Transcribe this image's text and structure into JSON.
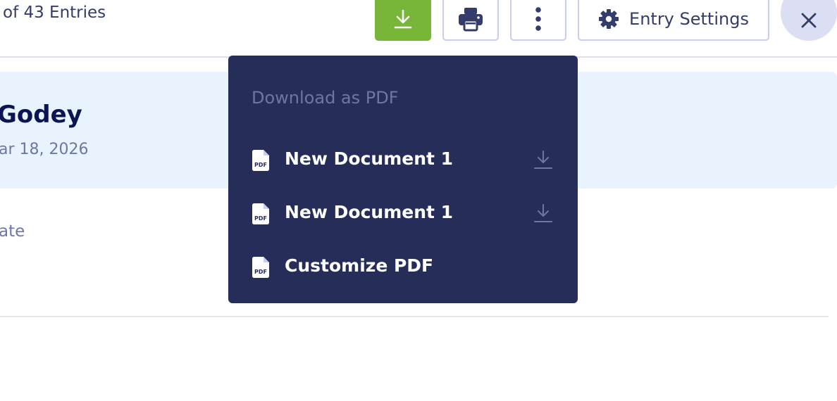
{
  "toolbar": {
    "entry_count_text": "of 43 Entries",
    "settings_label": "Entry Settings",
    "icons": {
      "download": "download-icon",
      "print": "print-icon",
      "more": "more-vertical-icon",
      "settings": "gear-icon",
      "close": "close-icon"
    },
    "colors": {
      "download_button": "#78b63a",
      "close_button": "#dcdff4"
    }
  },
  "submission": {
    "name": "Godey",
    "date": "ar 18, 2026",
    "field_label": "ate"
  },
  "download_menu": {
    "heading": "Download as PDF",
    "items": [
      {
        "label": "New Document 1",
        "icon": "pdf-file-icon",
        "action_icon": "download-icon"
      },
      {
        "label": "New Document 1",
        "icon": "pdf-file-icon",
        "action_icon": "download-icon"
      },
      {
        "label": "Customize PDF",
        "icon": "pdf-file-icon"
      }
    ],
    "colors": {
      "background": "#262d59",
      "heading": "#6e76a7"
    }
  }
}
